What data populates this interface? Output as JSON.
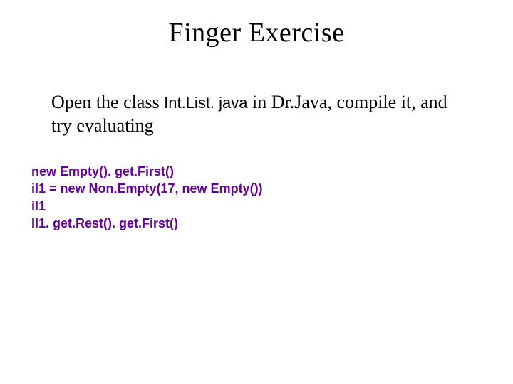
{
  "title": "Finger Exercise",
  "body": {
    "pre1": "Open the class ",
    "class_name": "Int.List. java",
    "post1": " in Dr.Java, compile it, and try evaluating"
  },
  "code": {
    "l1": "new Empty(). get.First()",
    "l2": "il1 = new Non.Empty(17, new Empty())",
    "l3": "il1",
    "l4": "Il1. get.Rest(). get.First()"
  }
}
